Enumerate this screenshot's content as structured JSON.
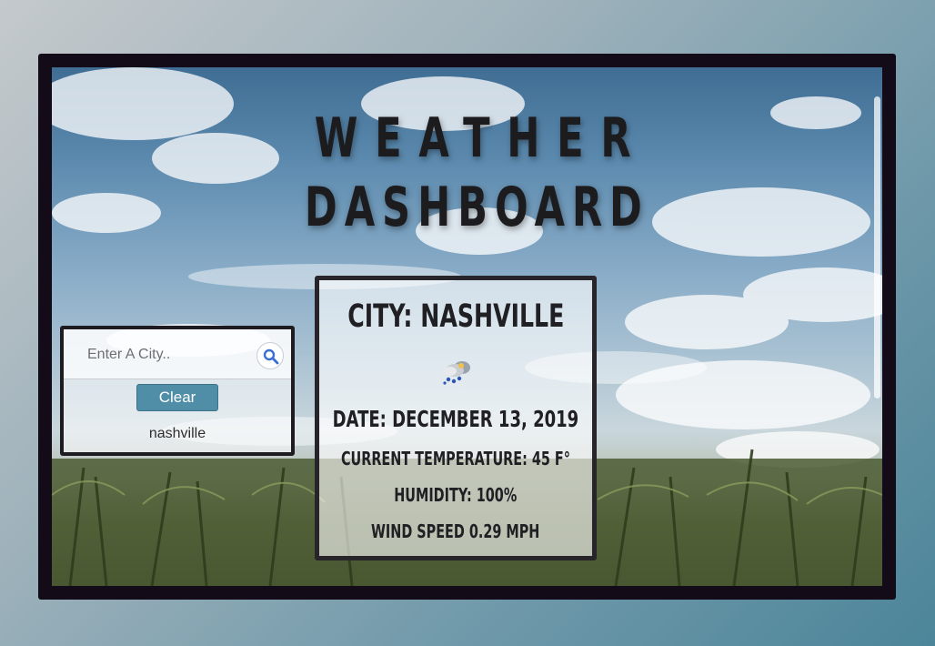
{
  "header": {
    "title_line1": "WEATHER",
    "title_line2": "DASHBOARD"
  },
  "search": {
    "placeholder": "Enter A City..",
    "value": "",
    "search_icon": "search-icon",
    "clear_label": "Clear",
    "history": [
      "nashville"
    ]
  },
  "weather": {
    "city": "City: Nashville",
    "icon": "snow-rain-cloud-icon",
    "date": "Date: December 13, 2019",
    "temperature": "Current Temperature: 45 F°",
    "humidity": "Humidity: 100%",
    "wind": "Wind Speed 0.29 MPH"
  }
}
